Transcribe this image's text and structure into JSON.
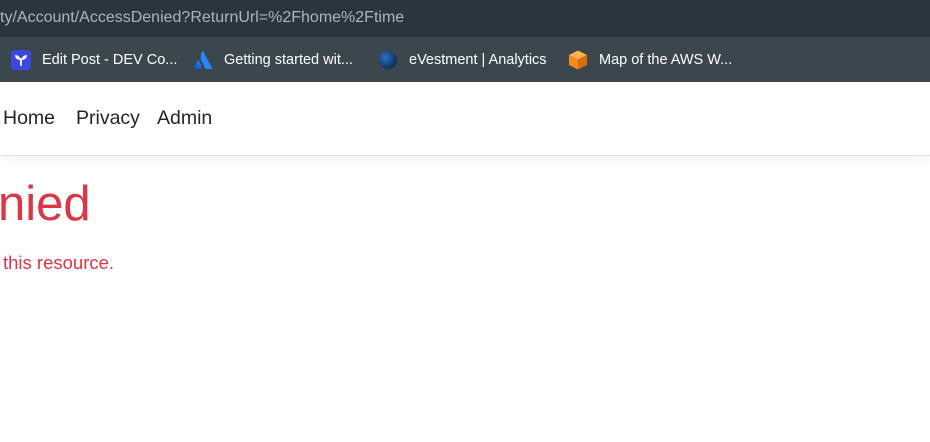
{
  "browser": {
    "address_text": "ty/Account/AccessDenied?ReturnUrl=%2Fhome%2Ftime",
    "bookmarks": [
      {
        "label": "Edit Post - DEV Co...",
        "icon": "dev-community-icon",
        "color": "#3b49df"
      },
      {
        "label": "Getting started wit...",
        "icon": "atlassian-icon",
        "color": "#2684ff"
      },
      {
        "label": "eVestment | Analytics",
        "icon": "evestment-globe-icon",
        "color": "#1a4a8a"
      },
      {
        "label": "Map of the AWS W...",
        "icon": "aws-cube-icon",
        "color": "#f58a1f"
      }
    ]
  },
  "nav": {
    "home": "Home",
    "privacy": "Privacy",
    "admin": "Admin"
  },
  "page": {
    "heading": "nied",
    "message": "this resource."
  },
  "colors": {
    "error_red": "#dc3545",
    "chrome_dark": "#2b353b",
    "chrome": "#3c474d"
  }
}
